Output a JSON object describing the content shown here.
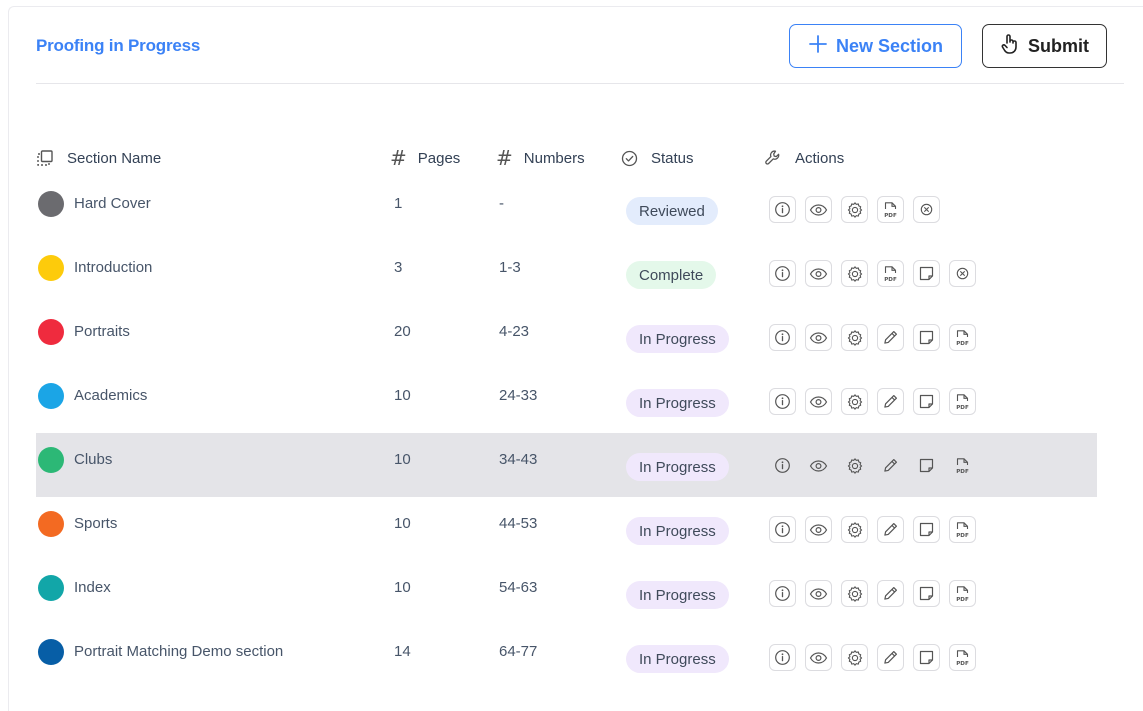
{
  "header": {
    "title": "Proofing in Progress",
    "new_section_label": "New Section",
    "submit_label": "Submit"
  },
  "columns": {
    "section_name": "Section Name",
    "pages": "Pages",
    "numbers": "Numbers",
    "status": "Status",
    "actions": "Actions"
  },
  "status_colors": {
    "Reviewed": "#e3ecfc",
    "Complete": "#e4f8ea",
    "In Progress": "#f0e8fc"
  },
  "rows": [
    {
      "name": "Hard Cover",
      "pages": "1",
      "numbers": "-",
      "status": "Reviewed",
      "color": "#6b6b6f",
      "actions": [
        "info",
        "view",
        "settings",
        "pdf",
        "remove"
      ],
      "highlight": false
    },
    {
      "name": "Introduction",
      "pages": "3",
      "numbers": "1-3",
      "status": "Complete",
      "color": "#fdcb0b",
      "actions": [
        "info",
        "view",
        "settings",
        "pdf",
        "comment",
        "remove"
      ],
      "highlight": false
    },
    {
      "name": "Portraits",
      "pages": "20",
      "numbers": "4-23",
      "status": "In Progress",
      "color": "#ef2b3e",
      "actions": [
        "info",
        "view",
        "settings",
        "edit",
        "comment",
        "pdf"
      ],
      "highlight": false
    },
    {
      "name": "Academics",
      "pages": "10",
      "numbers": "24-33",
      "status": "In Progress",
      "color": "#1ba5e6",
      "actions": [
        "info",
        "view",
        "settings",
        "edit",
        "comment",
        "pdf"
      ],
      "highlight": false
    },
    {
      "name": "Clubs",
      "pages": "10",
      "numbers": "34-43",
      "status": "In Progress",
      "color": "#2cb876",
      "actions": [
        "info",
        "view",
        "settings",
        "edit",
        "comment",
        "pdf"
      ],
      "highlight": true
    },
    {
      "name": "Sports",
      "pages": "10",
      "numbers": "44-53",
      "status": "In Progress",
      "color": "#f36a22",
      "actions": [
        "info",
        "view",
        "settings",
        "edit",
        "comment",
        "pdf"
      ],
      "highlight": false
    },
    {
      "name": "Index",
      "pages": "10",
      "numbers": "54-63",
      "status": "In Progress",
      "color": "#12a6a8",
      "actions": [
        "info",
        "view",
        "settings",
        "edit",
        "comment",
        "pdf"
      ],
      "highlight": false
    },
    {
      "name": "Portrait Matching Demo section",
      "pages": "14",
      "numbers": "64-77",
      "status": "In Progress",
      "color": "#075ea6",
      "actions": [
        "info",
        "view",
        "settings",
        "edit",
        "comment",
        "pdf"
      ],
      "highlight": false
    }
  ]
}
